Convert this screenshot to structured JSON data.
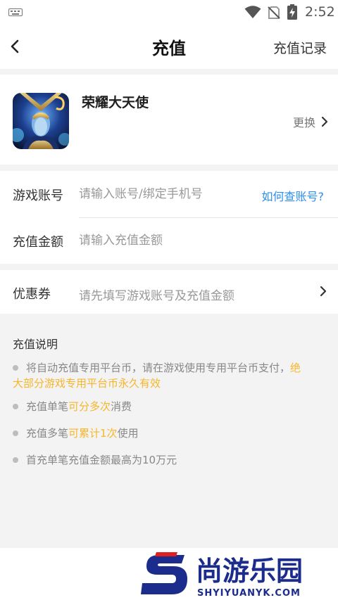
{
  "status_bar": {
    "time": "2:52",
    "icons": [
      "keyboard-icon",
      "wifi-icon",
      "no-sim-icon",
      "battery-charging-icon"
    ]
  },
  "header": {
    "back_icon": "chevron-left-icon",
    "title": "充值",
    "records_label": "充值记录"
  },
  "game": {
    "name": "荣耀大天使",
    "change_label": "更换",
    "change_icon": "chevron-right-icon"
  },
  "form": {
    "account": {
      "label": "游戏账号",
      "placeholder": "请输入账号/绑定手机号",
      "value": "",
      "help_link": "如何查账号?"
    },
    "amount": {
      "label": "充值金额",
      "placeholder": "请输入充值金额",
      "value": ""
    },
    "coupon": {
      "label": "优惠券",
      "hint": "请先填写游戏账号及充值金额",
      "icon": "chevron-right-icon"
    }
  },
  "notes": {
    "title": "充值说明",
    "items": [
      {
        "a": "将自动充值专用平台币，请在游戏使用专用平台币支付，",
        "b": "绝",
        "c": "大部分游戏专用平台币永久有效"
      },
      {
        "a": "充值单笔",
        "b": "可分多次",
        "c": "消费"
      },
      {
        "a": "充值多笔",
        "b": "可累计1次",
        "c": "使用"
      },
      {
        "a": "首充单笔充值金额最高为10万元"
      }
    ]
  },
  "watermark": {
    "brand": "尚游乐园",
    "domain": "SHYIYUANYK.COM"
  },
  "colors": {
    "accent_link": "#2b8ff0",
    "highlight": "#f6b62b",
    "watermark_blue": "#1b2c8c",
    "watermark_red": "#e02020"
  }
}
